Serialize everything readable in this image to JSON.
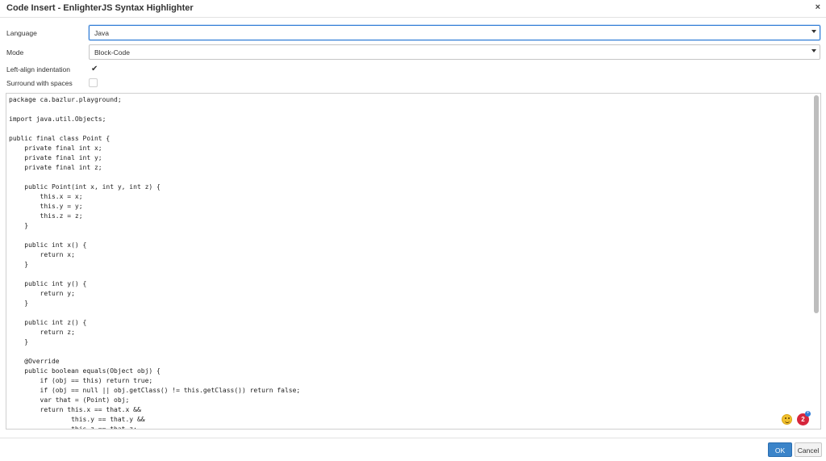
{
  "dialog": {
    "title": "Code Insert - EnlighterJS Syntax Highlighter",
    "close_glyph": "×"
  },
  "form": {
    "language_label": "Language",
    "language_value": "Java",
    "mode_label": "Mode",
    "mode_value": "Block-Code",
    "left_align_label": "Left-align indentation",
    "left_align_checked": true,
    "left_align_checkmark": "✔",
    "surround_label": "Surround with spaces",
    "surround_checked": false
  },
  "code_lines": [
    "package ca.bazlur.playground;",
    "",
    "import java.util.Objects;",
    "",
    "public final class Point {",
    "    private final int x;",
    "    private final int y;",
    "    private final int z;",
    "",
    "    public Point(int x, int y, int z) {",
    "        this.x = x;",
    "        this.y = y;",
    "        this.z = z;",
    "    }",
    "",
    "    public int x() {",
    "        return x;",
    "    }",
    "",
    "    public int y() {",
    "        return y;",
    "    }",
    "",
    "    public int z() {",
    "        return z;",
    "    }",
    "",
    "    @Override",
    "    public boolean equals(Object obj) {",
    "        if (obj == this) return true;",
    "        if (obj == null || obj.getClass() != this.getClass()) return false;",
    "        var that = (Point) obj;",
    "        return this.x == that.x &&",
    "                this.y == that.y &&",
    "                this.z == that.z;"
  ],
  "overlay": {
    "emoji_icon": "smiley-face-icon",
    "badge_count": "2",
    "badge_plus": "+"
  },
  "footer": {
    "ok_label": "OK",
    "cancel_label": "Cancel"
  },
  "colors": {
    "accent": "#3b84c9",
    "focus_border": "#2f7cd6",
    "badge": "#d6263c"
  }
}
